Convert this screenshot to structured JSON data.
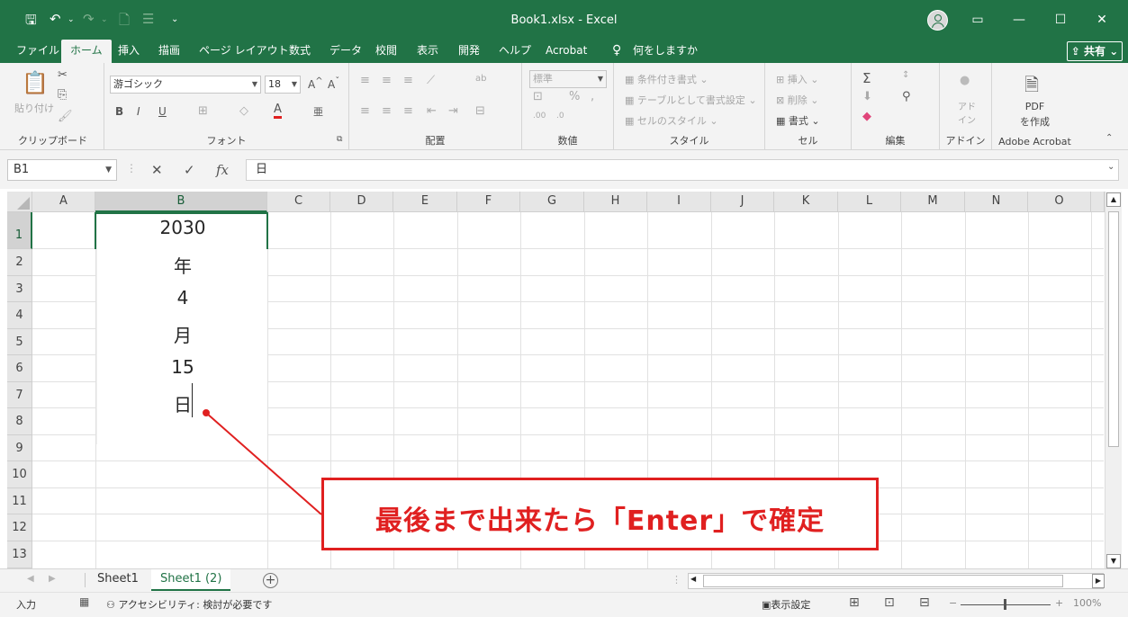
{
  "window": {
    "title": "Book1.xlsx  -  Excel",
    "theme_color": "#217346"
  },
  "tabs": [
    "ファイル",
    "ホーム",
    "挿入",
    "描画",
    "ページ レイアウト",
    "数式",
    "データ",
    "校閲",
    "表示",
    "開発",
    "ヘルプ",
    "Acrobat"
  ],
  "tell_me": "何をしますか",
  "share_label": "共有",
  "ribbon": {
    "clipboard": {
      "paste": "貼り付け",
      "label": "クリップボード"
    },
    "font": {
      "name": "游ゴシック",
      "size": "18",
      "label": "フォント"
    },
    "alignment": {
      "label": "配置"
    },
    "number": {
      "format": "標準",
      "label": "数値"
    },
    "styles": {
      "conditional": "条件付き書式",
      "table": "テーブルとして書式設定",
      "cell_styles": "セルのスタイル",
      "label": "スタイル"
    },
    "cells": {
      "insert": "挿入",
      "delete": "削除",
      "format": "書式",
      "label": "セル"
    },
    "editing": {
      "label": "編集"
    },
    "addins": {
      "button": "アド イン",
      "label": "アドイン"
    },
    "acrobat": {
      "button_line1": "PDF",
      "button_line2": "を作成",
      "label": "Adobe Acrobat"
    }
  },
  "formula_bar": {
    "name_box": "B1",
    "content": "日"
  },
  "grid": {
    "columns": [
      "A",
      "B",
      "C",
      "D",
      "E",
      "F",
      "G",
      "H",
      "I",
      "J",
      "K",
      "L",
      "M",
      "N",
      "O"
    ],
    "selected_column": "B",
    "rows": [
      "1",
      "2",
      "3",
      "4",
      "5",
      "6",
      "7",
      "8",
      "9",
      "10",
      "11",
      "12",
      "13"
    ],
    "selected_row": "1",
    "editing_cell_lines": [
      "2030",
      "年",
      "4",
      "月",
      "15",
      "日"
    ]
  },
  "callout": {
    "text": "最後まで出来たら「Enter」で確定",
    "color": "#e02020"
  },
  "sheets": {
    "tabs": [
      "Sheet1",
      "Sheet1 (2)"
    ],
    "active": "Sheet1 (2)"
  },
  "status": {
    "mode": "入力",
    "accessibility": "アクセシビリティ: 検討が必要です",
    "display_settings": "表示設定",
    "zoom": "100%"
  }
}
